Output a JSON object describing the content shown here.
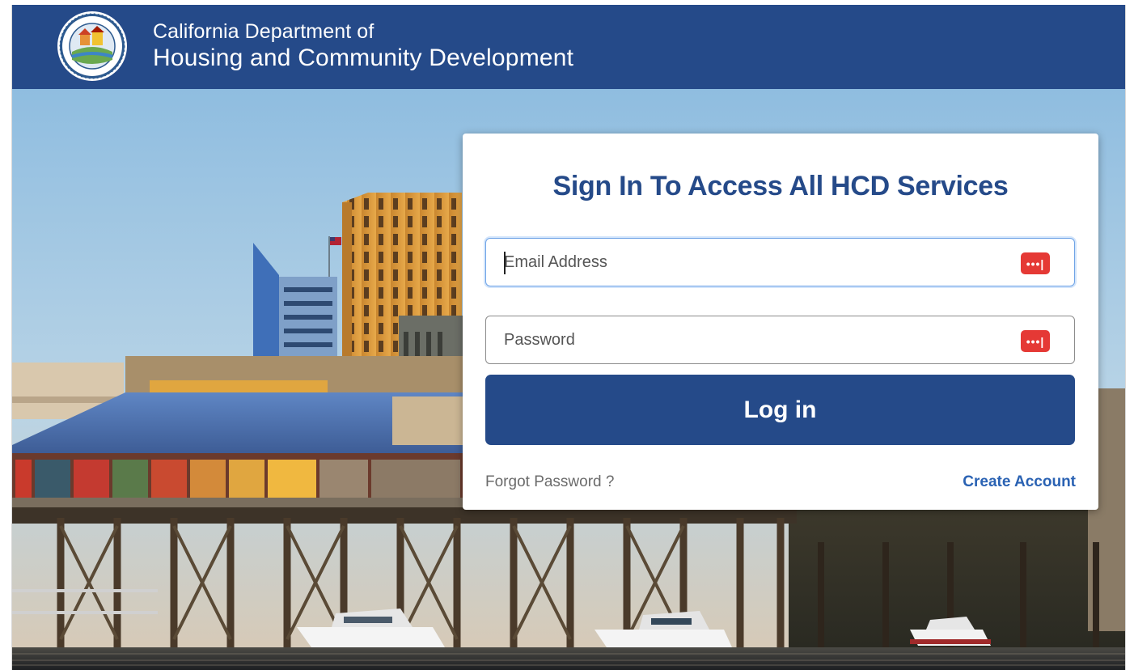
{
  "header": {
    "line1": "California Department of",
    "line2": "Housing and Community Development",
    "logo": "hcd-seal-logo"
  },
  "login": {
    "title": "Sign In To Access All HCD Services",
    "email_placeholder": "Email Address",
    "email_value": "",
    "password_placeholder": "Password",
    "password_value": "",
    "field_icon": "password-manager-icon",
    "field_icon_glyph": "•••|",
    "login_label": "Log in",
    "forgot_label": "Forgot Password ?",
    "create_label": "Create Account"
  },
  "colors": {
    "brand_blue": "#254a89",
    "link_blue": "#2a62b3",
    "icon_red": "#e53935"
  }
}
